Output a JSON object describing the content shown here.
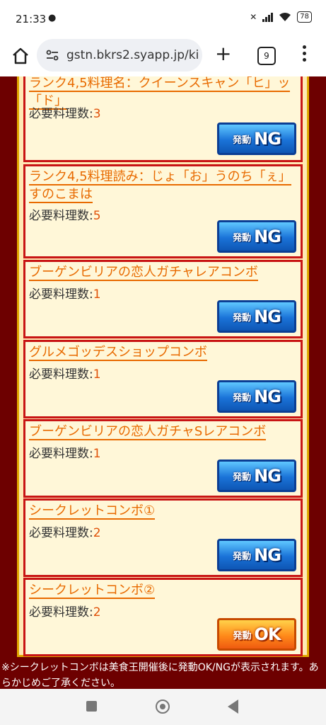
{
  "status": {
    "time": "21:33",
    "battery": "78"
  },
  "browser": {
    "url": "gstn.bkrs2.syapp.jp/ki",
    "tab_count": "9"
  },
  "cards": [
    {
      "title": "ランク4,5料理名：クイーンスキャン「ヒ」ッ「ド」",
      "req_label": "必要料理数:",
      "req_value": "3",
      "badge_small": "発動",
      "badge_big": "NG",
      "status": "NG"
    },
    {
      "title": "ランク4,5料理読み：じょ「お」うのち「ぇ」すのこまは",
      "req_label": "必要料理数:",
      "req_value": "5",
      "badge_small": "発動",
      "badge_big": "NG",
      "status": "NG"
    },
    {
      "title": "ブーゲンビリアの恋人ガチャレアコンボ",
      "req_label": "必要料理数:",
      "req_value": "1",
      "badge_small": "発動",
      "badge_big": "NG",
      "status": "NG"
    },
    {
      "title": "グルメゴッデスショップコンボ",
      "req_label": "必要料理数:",
      "req_value": "1",
      "badge_small": "発動",
      "badge_big": "NG",
      "status": "NG"
    },
    {
      "title": "ブーゲンビリアの恋人ガチャSレアコンボ",
      "req_label": "必要料理数:",
      "req_value": "1",
      "badge_small": "発動",
      "badge_big": "NG",
      "status": "NG"
    },
    {
      "title": "シークレットコンボ①",
      "req_label": "必要料理数:",
      "req_value": "2",
      "badge_small": "発動",
      "badge_big": "NG",
      "status": "NG"
    },
    {
      "title": "シークレットコンボ②",
      "req_label": "必要料理数:",
      "req_value": "2",
      "badge_small": "発動",
      "badge_big": "OK",
      "status": "OK"
    }
  ],
  "note": "※シークレットコンボは美食王開催後に発動OK/NGが表示されます。あらかじめご了承ください。",
  "colors": {
    "page_bg": "#6d0000",
    "card_border": "#c81414",
    "card_bg": "#fff7d8",
    "title": "#e86a00",
    "ng": "#1a73d8",
    "ok": "#ff8a1a"
  }
}
